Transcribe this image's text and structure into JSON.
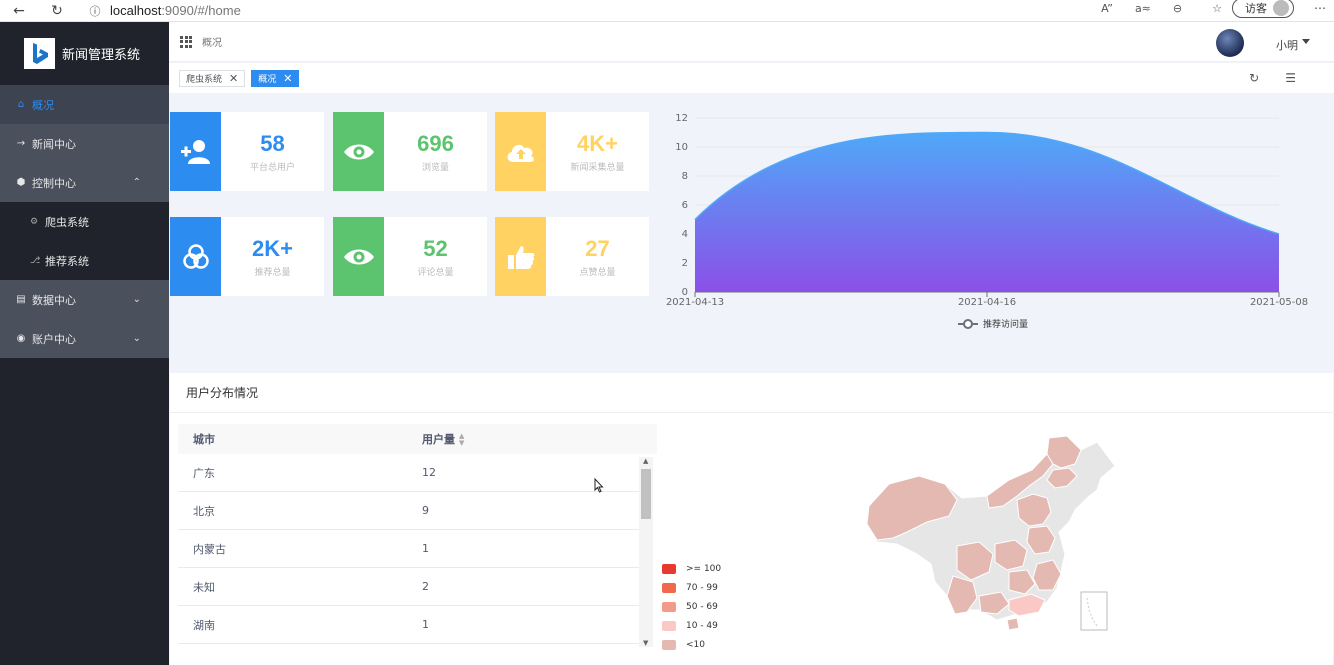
{
  "browser": {
    "url_host": "localhost",
    "url_rest": ":9090/#/home",
    "visitor_label": "访客"
  },
  "sidebar": {
    "app_title": "新闻管理系统",
    "items": [
      {
        "label": "概况",
        "icon": "home-icon",
        "active": true
      },
      {
        "label": "新闻中心",
        "icon": "arrow-right-icon"
      },
      {
        "label": "控制中心",
        "icon": "cube-icon",
        "expanded": true
      },
      {
        "label": "爬虫系统",
        "icon": "spider-icon",
        "sub": true
      },
      {
        "label": "推荐系统",
        "icon": "branch-icon",
        "sub": true
      },
      {
        "label": "数据中心",
        "icon": "database-icon"
      },
      {
        "label": "账户中心",
        "icon": "user-circle-icon"
      }
    ]
  },
  "header": {
    "breadcrumb": "概况",
    "user_name": "小明"
  },
  "tags": [
    {
      "label": "爬虫系统",
      "active": false
    },
    {
      "label": "概况",
      "active": true
    }
  ],
  "stats": [
    {
      "value": "58",
      "label": "平台总用户",
      "color": "#2d8cf0",
      "icon": "add-user-icon"
    },
    {
      "value": "696",
      "label": "浏览量",
      "color": "#5cc46f",
      "icon": "eye-icon"
    },
    {
      "value": "4K+",
      "label": "新闻采集总量",
      "color": "#ffd262",
      "icon": "cloud-upload-icon"
    },
    {
      "value": "2K+",
      "label": "推荐总量",
      "color": "#2d8cf0",
      "icon": "circles-icon"
    },
    {
      "value": "52",
      "label": "评论总量",
      "color": "#5cc46f",
      "icon": "eye-icon"
    },
    {
      "value": "27",
      "label": "点赞总量",
      "color": "#ffd262",
      "icon": "thumbs-up-icon"
    }
  ],
  "chart_data": {
    "type": "area",
    "x": [
      "2021-04-13",
      "2021-04-16",
      "2021-05-08"
    ],
    "series": [
      {
        "name": "推荐访问量",
        "values": [
          5,
          11,
          4
        ]
      }
    ],
    "ylim": [
      0,
      12
    ],
    "yticks": [
      0,
      2,
      4,
      6,
      8,
      10,
      12
    ],
    "legend_position": "bottom",
    "smooth": true,
    "gradient": [
      "#4fa8f8",
      "#8b50e8"
    ]
  },
  "distribution": {
    "title": "用户分布情况",
    "columns": [
      "城市",
      "用户量"
    ],
    "rows": [
      [
        "广东",
        "12"
      ],
      [
        "北京",
        "9"
      ],
      [
        "内蒙古",
        "1"
      ],
      [
        "未知",
        "2"
      ],
      [
        "湖南",
        "1"
      ]
    ],
    "legend": [
      {
        "label": ">= 100",
        "color": "#e8392e"
      },
      {
        "label": "70 - 99",
        "color": "#f0694f"
      },
      {
        "label": "50 - 69",
        "color": "#f39a8a"
      },
      {
        "label": "10 - 49",
        "color": "#fbc9c5"
      },
      {
        "label": "<10",
        "color": "#e3b9b2"
      }
    ]
  }
}
